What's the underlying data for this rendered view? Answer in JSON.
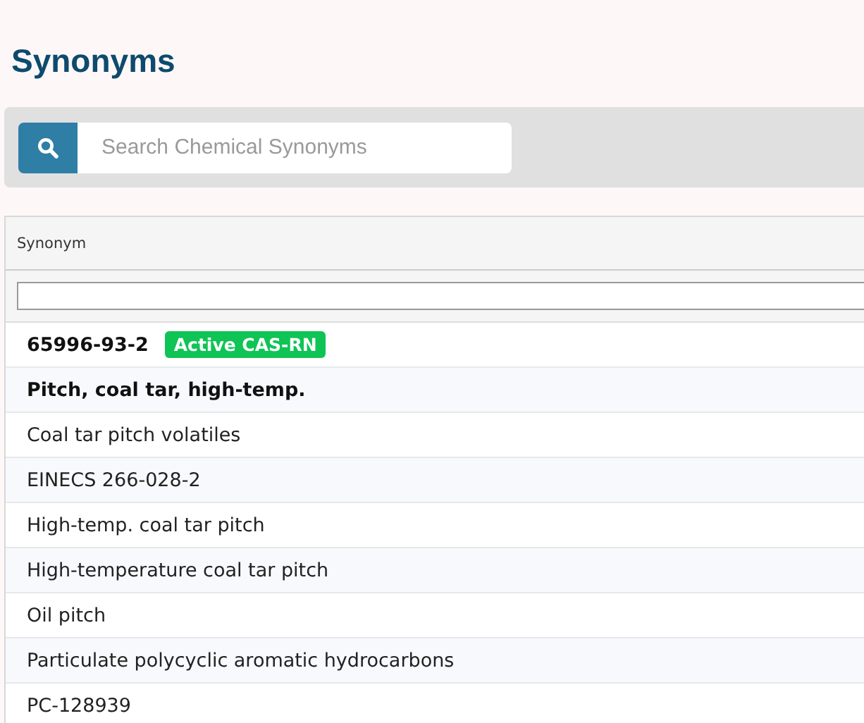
{
  "heading": "Synonyms",
  "search": {
    "placeholder": "Search Chemical Synonyms"
  },
  "table": {
    "columns": [
      "Synonym"
    ],
    "rows": [
      {
        "kind": "casrn",
        "text": "65996-93-2",
        "badge": "Active CAS-RN"
      },
      {
        "kind": "bold",
        "text": "Pitch, coal tar, high-temp."
      },
      {
        "kind": "plain",
        "text": "Coal tar pitch volatiles"
      },
      {
        "kind": "plain",
        "text": "EINECS 266-028-2"
      },
      {
        "kind": "plain",
        "text": "High-temp. coal tar pitch"
      },
      {
        "kind": "plain",
        "text": "High-temperature coal tar pitch"
      },
      {
        "kind": "plain",
        "text": "Oil pitch"
      },
      {
        "kind": "plain",
        "text": "Particulate polycyclic aromatic hydrocarbons"
      },
      {
        "kind": "plain",
        "text": "PC-128939"
      }
    ]
  }
}
